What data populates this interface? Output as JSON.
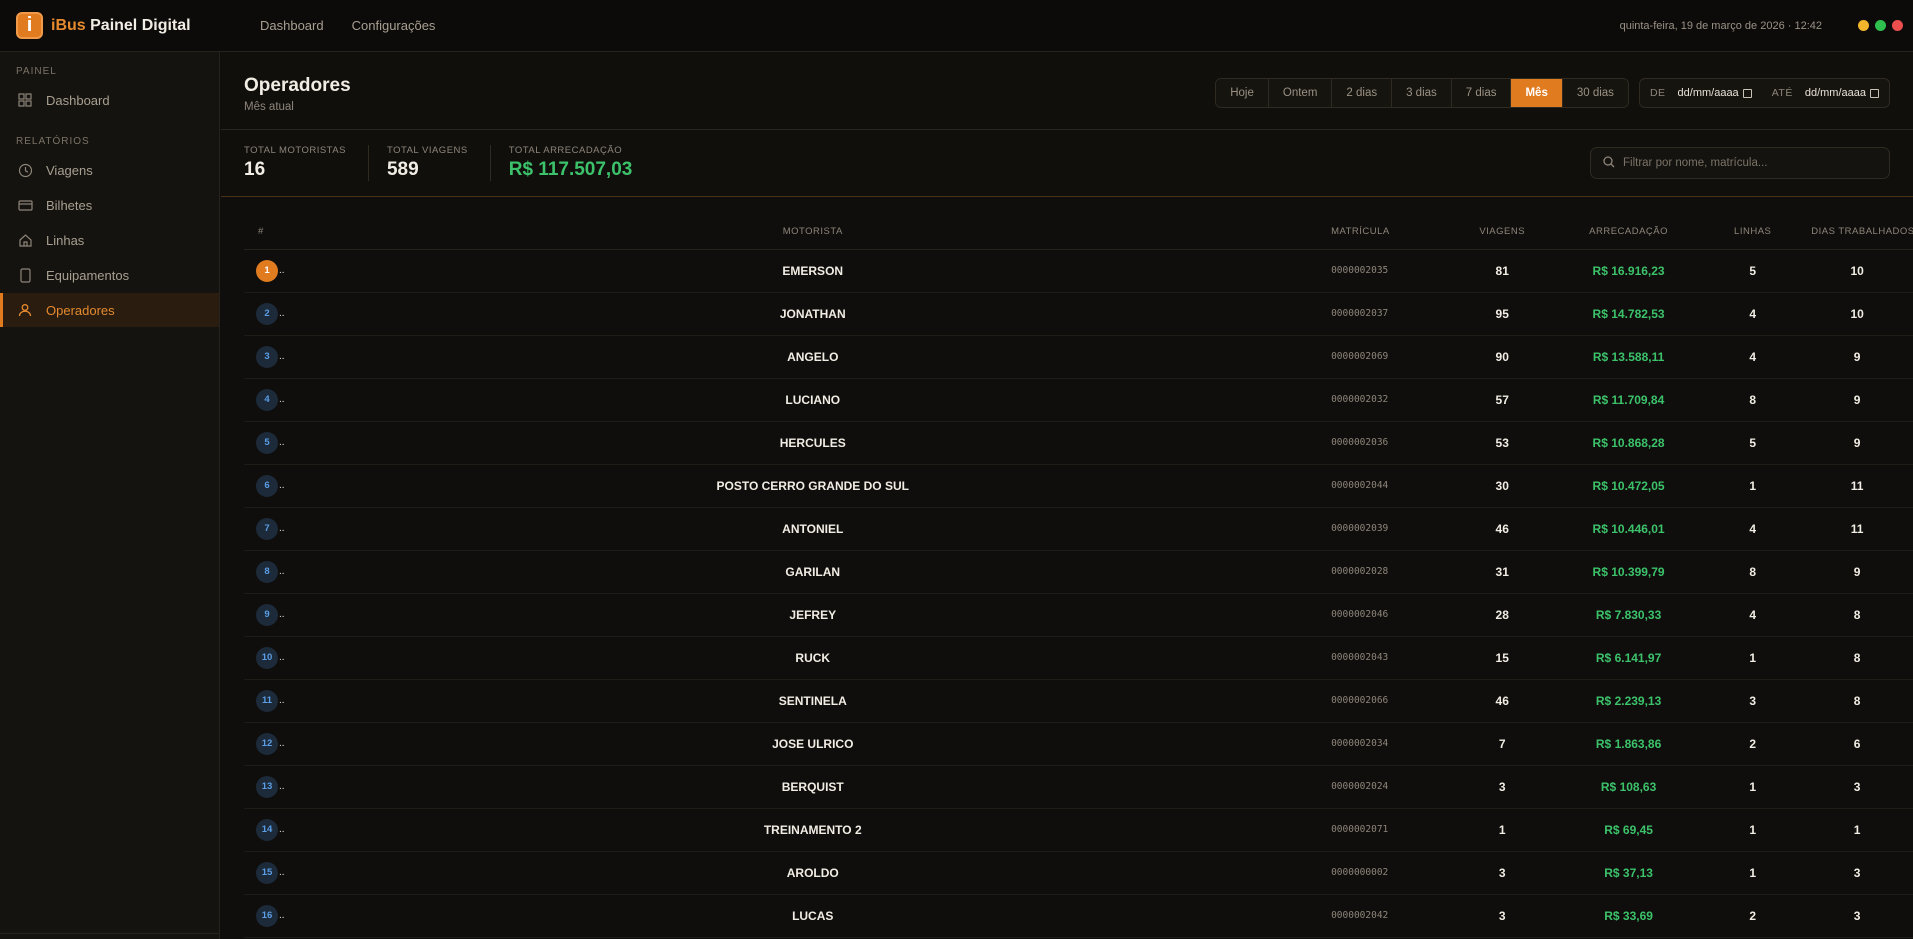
{
  "brand": {
    "prefix": "iBus",
    "suffix": " Painel Digital",
    "logo_letter": "i"
  },
  "topnav": {
    "items": [
      "Dashboard",
      "Configurações"
    ]
  },
  "datetime": "quinta-feira, 19 de março de 2026 · 12:42",
  "window_controls": {
    "colors": [
      "#f2b52b",
      "#2fbf4f",
      "#ec4e4e"
    ]
  },
  "sidebar": {
    "section_painel": "PAINEL",
    "painel_items": [
      {
        "label": "Dashboard",
        "icon": "grid-icon"
      }
    ],
    "section_relatorios": "RELATÓRIOS",
    "relatorios_items": [
      {
        "label": "Viagens",
        "icon": "clock-icon"
      },
      {
        "label": "Bilhetes",
        "icon": "card-icon"
      },
      {
        "label": "Linhas",
        "icon": "home-icon"
      },
      {
        "label": "Equipamentos",
        "icon": "device-icon"
      },
      {
        "label": "Operadores",
        "icon": "user-icon",
        "active": true
      }
    ]
  },
  "page": {
    "title": "Operadores",
    "subtitle": "Mês atual"
  },
  "ranges": [
    "Hoje",
    "Ontem",
    "2 dias",
    "3 dias",
    "7 dias",
    "Mês",
    "30 dias"
  ],
  "active_range": "Mês",
  "date_filter": {
    "from_label": "DE",
    "from_value": "dd/mm/aaaa",
    "to_label": "ATÉ",
    "to_value": "dd/mm/aaaa"
  },
  "stats": {
    "motoristas_label": "TOTAL MOTORISTAS",
    "motoristas_value": "16",
    "viagens_label": "TOTAL VIAGENS",
    "viagens_value": "589",
    "arrecadacao_label": "TOTAL ARRECADAÇÃO",
    "arrecadacao_value": "R$ 117.507,03"
  },
  "search": {
    "placeholder": "Filtrar por nome, matrícula..."
  },
  "table": {
    "headers": {
      "rank": "#",
      "motorista": "MOTORISTA",
      "matricula": "MATRÍCULA",
      "viagens": "VIAGENS",
      "arrecadacao": "ARRECADAÇÃO",
      "linhas": "LINHAS",
      "dias": "DIAS TRABALHADOS"
    },
    "rows": [
      {
        "rank": "1",
        "name": "EMERSON",
        "mat": "0000002035",
        "viagens": "81",
        "arrec": "R$ 16.916,23",
        "linhas": "5",
        "dias": "10"
      },
      {
        "rank": "2",
        "name": "JONATHAN",
        "mat": "0000002037",
        "viagens": "95",
        "arrec": "R$ 14.782,53",
        "linhas": "4",
        "dias": "10"
      },
      {
        "rank": "3",
        "name": "ANGELO",
        "mat": "0000002069",
        "viagens": "90",
        "arrec": "R$ 13.588,11",
        "linhas": "4",
        "dias": "9"
      },
      {
        "rank": "4",
        "name": "LUCIANO",
        "mat": "0000002032",
        "viagens": "57",
        "arrec": "R$ 11.709,84",
        "linhas": "8",
        "dias": "9"
      },
      {
        "rank": "5",
        "name": "HERCULES",
        "mat": "0000002036",
        "viagens": "53",
        "arrec": "R$ 10.868,28",
        "linhas": "5",
        "dias": "9"
      },
      {
        "rank": "6",
        "name": "POSTO CERRO GRANDE DO SUL",
        "mat": "0000002044",
        "viagens": "30",
        "arrec": "R$ 10.472,05",
        "linhas": "1",
        "dias": "11"
      },
      {
        "rank": "7",
        "name": "ANTONIEL",
        "mat": "0000002039",
        "viagens": "46",
        "arrec": "R$ 10.446,01",
        "linhas": "4",
        "dias": "11"
      },
      {
        "rank": "8",
        "name": "GARILAN",
        "mat": "0000002028",
        "viagens": "31",
        "arrec": "R$ 10.399,79",
        "linhas": "8",
        "dias": "9"
      },
      {
        "rank": "9",
        "name": "JEFREY",
        "mat": "0000002046",
        "viagens": "28",
        "arrec": "R$ 7.830,33",
        "linhas": "4",
        "dias": "8"
      },
      {
        "rank": "10",
        "name": "RUCK",
        "mat": "0000002043",
        "viagens": "15",
        "arrec": "R$ 6.141,97",
        "linhas": "1",
        "dias": "8"
      },
      {
        "rank": "11",
        "name": "SENTINELA",
        "mat": "0000002066",
        "viagens": "46",
        "arrec": "R$ 2.239,13",
        "linhas": "3",
        "dias": "8"
      },
      {
        "rank": "12",
        "name": "JOSE ULRICO",
        "mat": "0000002034",
        "viagens": "7",
        "arrec": "R$ 1.863,86",
        "linhas": "2",
        "dias": "6"
      },
      {
        "rank": "13",
        "name": "BERQUIST",
        "mat": "0000002024",
        "viagens": "3",
        "arrec": "R$ 108,63",
        "linhas": "1",
        "dias": "3"
      },
      {
        "rank": "14",
        "name": "TREINAMENTO 2",
        "mat": "0000002071",
        "viagens": "1",
        "arrec": "R$ 69,45",
        "linhas": "1",
        "dias": "1"
      },
      {
        "rank": "15",
        "name": "AROLDO",
        "mat": "0000000002",
        "viagens": "3",
        "arrec": "R$ 37,13",
        "linhas": "1",
        "dias": "3"
      },
      {
        "rank": "16",
        "name": "LUCAS",
        "mat": "0000002042",
        "viagens": "3",
        "arrec": "R$ 33,69",
        "linhas": "2",
        "dias": "3"
      }
    ]
  }
}
